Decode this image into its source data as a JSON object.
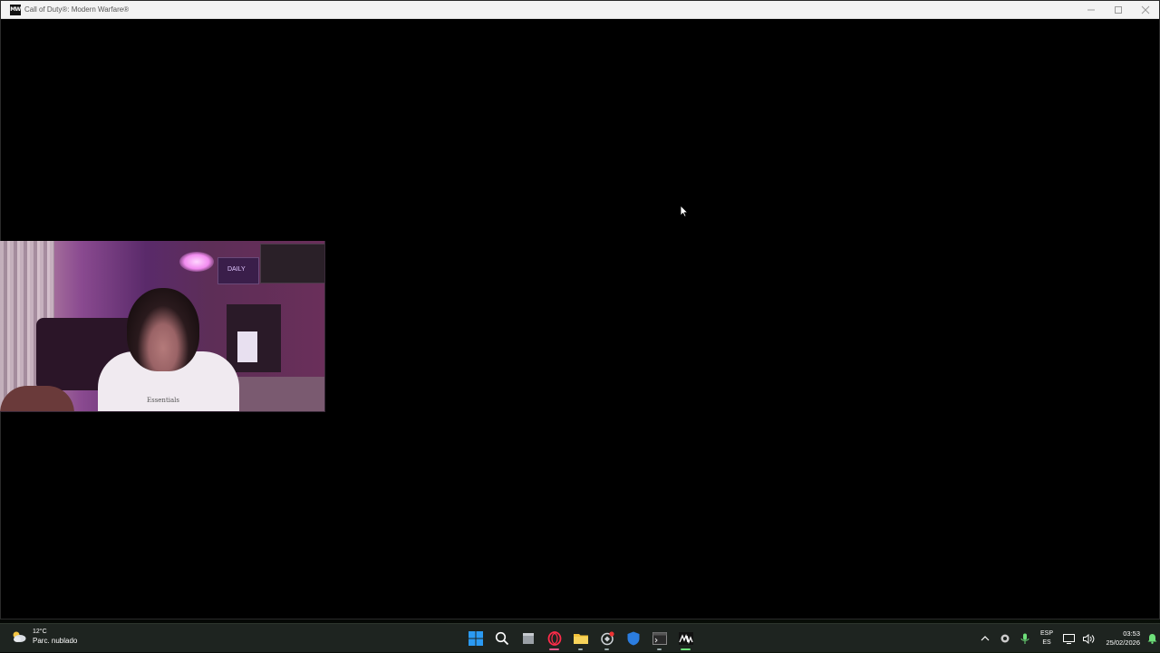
{
  "window": {
    "title": "Call of Duty®: Modern Warfare®",
    "app_icon_label": "MW"
  },
  "webcam": {
    "poster_text": "DAILY",
    "shirt_text": "Essentials"
  },
  "taskbar": {
    "weather": {
      "temperature": "12°C",
      "condition": "Parc. nublado",
      "icon": "partly-cloudy-icon"
    },
    "apps": [
      {
        "name": "start",
        "icon": "windows-start-icon"
      },
      {
        "name": "search",
        "icon": "search-icon"
      },
      {
        "name": "file-manager-app",
        "icon": "window-icon"
      },
      {
        "name": "opera-gx",
        "icon": "opera-icon"
      },
      {
        "name": "file-explorer",
        "icon": "folder-icon"
      },
      {
        "name": "app-red-badge",
        "icon": "spark-icon"
      },
      {
        "name": "windows-security",
        "icon": "shield-icon"
      },
      {
        "name": "terminal",
        "icon": "terminal-icon"
      },
      {
        "name": "modern-warfare",
        "icon": "mw-icon"
      }
    ],
    "tray": {
      "language_top": "ESP",
      "language_bottom": "ES",
      "time": "03:53",
      "date": "25/02/2026"
    }
  },
  "colors": {
    "titlebar": "#f3f3f3",
    "taskbar": "#1e2420",
    "accent_green": "#6ee07a",
    "windows_blue": "#2b9af3"
  }
}
